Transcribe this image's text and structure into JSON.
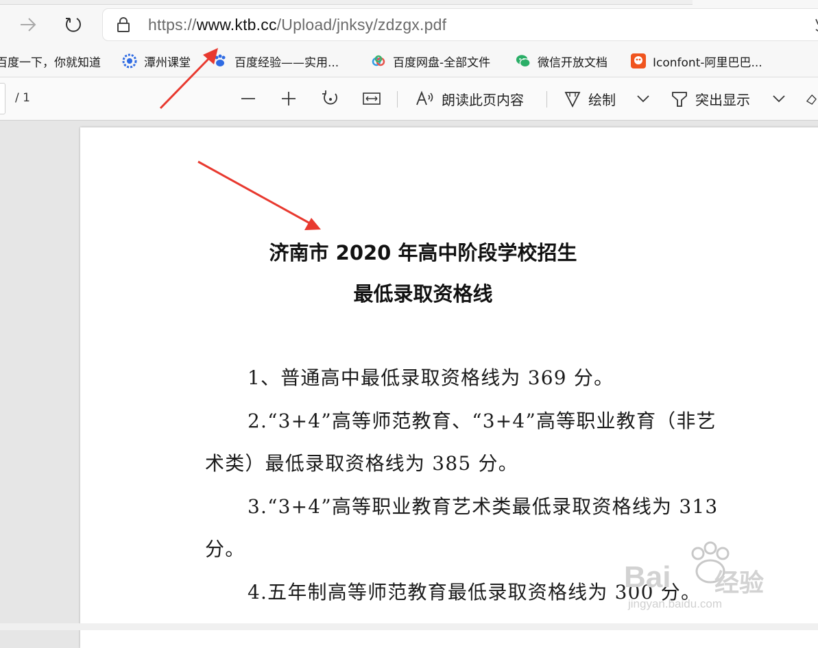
{
  "browser": {
    "url_scheme": "https://",
    "url_host": "www.ktb.cc",
    "url_path": "/Upload/jnksy/zdzgx.pdf"
  },
  "favorites": [
    {
      "label": "百度一下，你就知道",
      "icon": "baidu-icon"
    },
    {
      "label": "潭州课堂",
      "icon": "gear-badge-icon"
    },
    {
      "label": "百度经验——实用...",
      "icon": "baidu-paw-icon"
    },
    {
      "label": "百度网盘-全部文件",
      "icon": "cloud-icon"
    },
    {
      "label": "微信开放文档",
      "icon": "wechat-icon"
    },
    {
      "label": "Iconfont-阿里巴巴...",
      "icon": "iconfont-icon"
    }
  ],
  "pdf_toolbar": {
    "page_count": "/ 1",
    "read_aloud": "朗读此页内容",
    "draw": "绘制",
    "highlight": "突出显示"
  },
  "document": {
    "title_line1": "济南市 2020 年高中阶段学校招生",
    "title_line2": "最低录取资格线",
    "p1": "1、普通高中最低录取资格线为 369 分。",
    "p2_line1": "2.“3+4”高等师范教育、“3+4”高等职业教育（非艺",
    "p2_line2": "术类）最低录取资格线为 385 分。",
    "p3_line1": "3.“3+4”高等职业教育艺术类最低录取资格线为 313",
    "p3_line2": "分。",
    "p4": "4.五年制高等师范教育最低录取资格线为 300 分。"
  },
  "watermark": {
    "brand": "Bai",
    "brand2": "经验",
    "site": "jingyan.baidu.com"
  },
  "colors": {
    "annotation_arrow": "#e8392f",
    "wechat": "#2aae67",
    "iconfont": "#f0541e",
    "baidu_blue": "#2f6be3"
  }
}
